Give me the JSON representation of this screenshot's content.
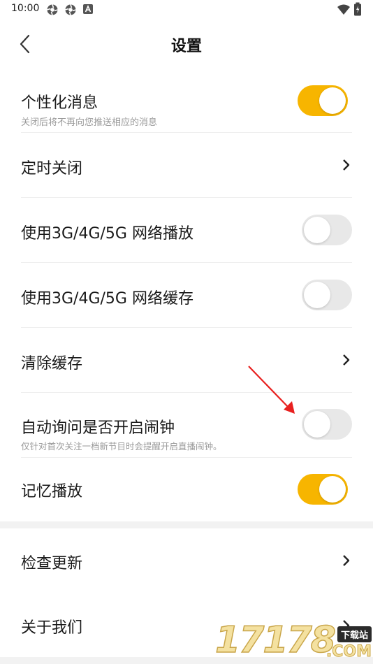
{
  "status_bar": {
    "time": "10:00"
  },
  "header": {
    "title": "设置"
  },
  "settings": [
    {
      "title": "个性化消息",
      "subtitle": "关闭后将不再向您推送相应的消息",
      "control": "toggle",
      "on": true
    },
    {
      "title": "定时关闭",
      "control": "chevron"
    },
    {
      "title": "使用3G/4G/5G 网络播放",
      "control": "toggle",
      "on": false
    },
    {
      "title": "使用3G/4G/5G 网络缓存",
      "control": "toggle",
      "on": false
    },
    {
      "title": "清除缓存",
      "control": "chevron"
    },
    {
      "title": "自动询问是否开启闹钟",
      "subtitle": "仅针对首次关注一档新节目时会提醒开启直播闹钟。",
      "control": "toggle",
      "on": false
    },
    {
      "title": "记忆播放",
      "control": "toggle",
      "on": true
    }
  ],
  "more": [
    {
      "title": "检查更新",
      "control": "chevron"
    },
    {
      "title": "关于我们",
      "control": "chevron"
    }
  ],
  "watermark": {
    "digits": "17178",
    "suffix": ".COM",
    "badge": "下载站"
  },
  "colors": {
    "accent": "#f7b500",
    "toggle_off": "#e8e8e8",
    "annotation_arrow": "#e8201f"
  }
}
